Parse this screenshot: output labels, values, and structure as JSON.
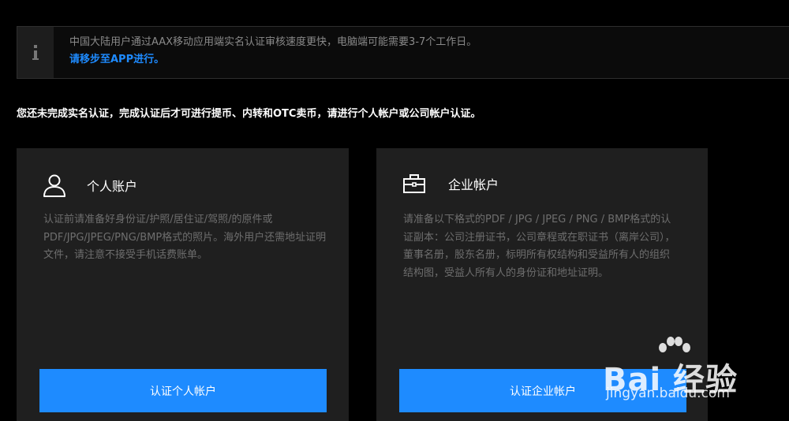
{
  "notice": {
    "icon": "info-icon",
    "line1": "中国大陆用户通过AAX移动应用端实名认证审核速度更快，电脑端可能需要3-7个工作日。",
    "link": "请移步至APP进行。"
  },
  "instruction": "您还未完成实名认证，完成认证后才可进行提币、内转和OTC卖币，请进行个人帐户或公司帐户认证。",
  "cards": [
    {
      "icon": "user-icon",
      "title": "个人账户",
      "description": "认证前请准备好身份证/护照/居住证/驾照/的原件或PDF/JPG/JPEG/PNG/BMP格式的照片。海外用户还需地址证明文件，请注意不接受手机话费账单。",
      "button": "认证个人帐户"
    },
    {
      "icon": "briefcase-icon",
      "title": "企业帐户",
      "description": "请准备以下格式的PDF / JPG / JPEG / PNG / BMP格式的认证副本：公司注册证书，公司章程或在职证书（离岸公司），董事名册，股东名册，标明所有权结构和受益所有人的组织结构图，受益人所有人的身份证和地址证明。",
      "button": "认证企业帐户"
    }
  ],
  "watermark": {
    "brand": "Bai 经验",
    "url": "jingyan.baidu.com"
  },
  "colors": {
    "accent": "#1e8bff",
    "background": "#000000",
    "card": "#1f1f1f",
    "muted_text": "#6e6e6e"
  }
}
